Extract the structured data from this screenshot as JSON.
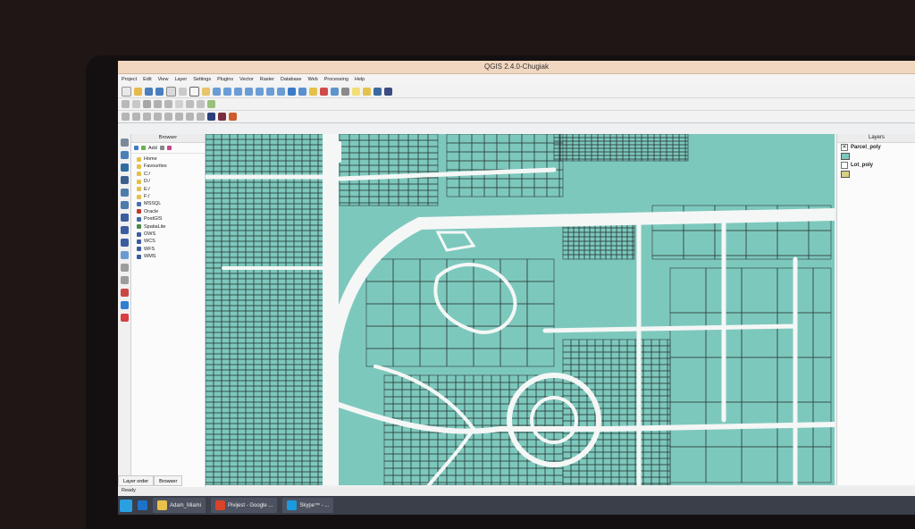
{
  "window": {
    "title": "QGIS 2.4.0-Chugiak"
  },
  "menu": [
    "Project",
    "Edit",
    "View",
    "Layer",
    "Settings",
    "Plugins",
    "Vector",
    "Raster",
    "Database",
    "Web",
    "Processing",
    "Help"
  ],
  "browser": {
    "title": "Browser",
    "add_label": "Add",
    "items": [
      "Home",
      "Favourites",
      "C:/",
      "D:/",
      "E:/",
      "F:/",
      "MSSQL",
      "Oracle",
      "PostGIS",
      "SpatiaLite",
      "OWS",
      "WCS",
      "WFS",
      "WMS"
    ]
  },
  "layers_panel": {
    "title": "Layers",
    "layers": [
      {
        "name": "Parcel_poly",
        "color": "#7dc8bd",
        "checked": true
      },
      {
        "name": "Lot_poly",
        "color": "#d8cf86",
        "checked": false
      }
    ]
  },
  "bottom_tabs": [
    "Layer order",
    "Browser"
  ],
  "status_text": "Ready",
  "taskbar": {
    "items": [
      "Adam_Miami",
      "Pivijest - Google ...",
      "Skype™ - ..."
    ]
  },
  "colors": {
    "parcel_fill": "#7dc8bd",
    "road": "#f4f7f6",
    "parcel_stroke": "#2a3a38",
    "title_bar": "#f1d7c0"
  }
}
